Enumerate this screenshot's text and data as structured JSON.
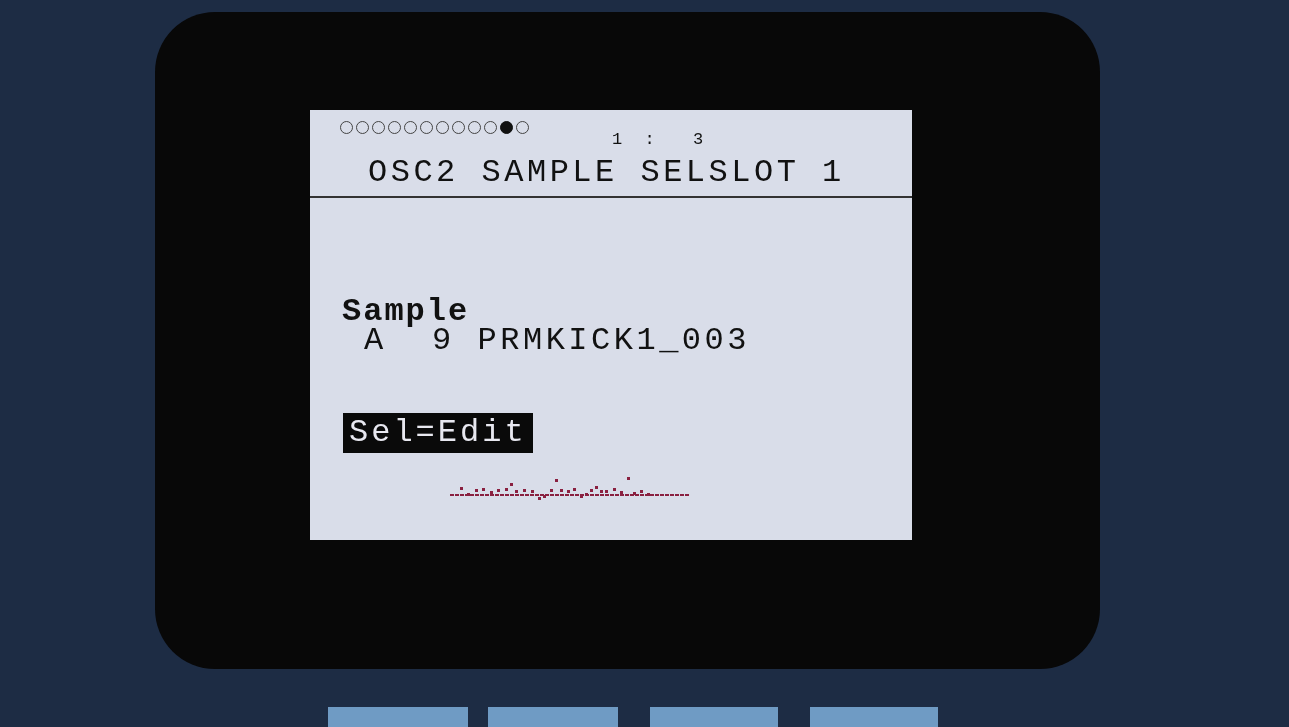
{
  "header": {
    "page_dots": [
      {
        "selected": false
      },
      {
        "selected": false
      },
      {
        "selected": false
      },
      {
        "selected": false
      },
      {
        "selected": false
      },
      {
        "selected": false
      },
      {
        "selected": false
      },
      {
        "selected": false
      },
      {
        "selected": false
      },
      {
        "selected": false
      },
      {
        "selected": true
      },
      {
        "selected": false
      }
    ],
    "position": "1 :  3",
    "title": "OSC2 SAMPLE SELSLOT 1"
  },
  "parameter": {
    "label": "Sample",
    "value": "A  9 PRMKICK1_003"
  },
  "hint": "Sel=Edit"
}
